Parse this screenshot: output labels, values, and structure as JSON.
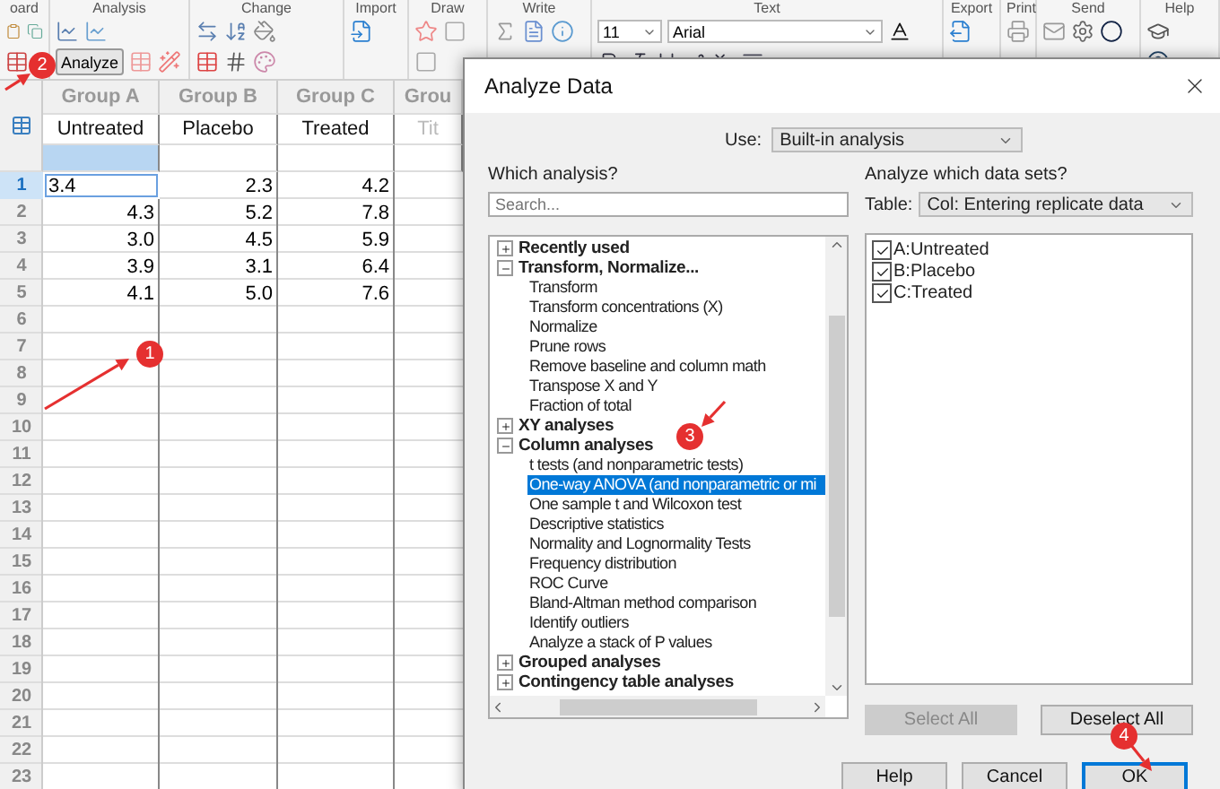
{
  "ribbon": [
    {
      "kind": "clipboard",
      "label": "oard"
    },
    {
      "kind": "analysis",
      "label": "Analysis",
      "button": "Analyze"
    },
    {
      "kind": "change",
      "label": "Change"
    },
    {
      "kind": "import",
      "label": "Import"
    },
    {
      "kind": "draw",
      "label": "Draw"
    },
    {
      "kind": "write",
      "label": "Write"
    },
    {
      "kind": "text",
      "label": "Text",
      "font_size": "11",
      "font": "Arial"
    },
    {
      "kind": "export",
      "label": "Export"
    },
    {
      "kind": "print",
      "label": "Print"
    },
    {
      "kind": "send",
      "label": "Send"
    },
    {
      "kind": "help",
      "label": "Help"
    }
  ],
  "sheet": {
    "columns": [
      {
        "group": "Group A",
        "title": "Untreated",
        "selected": true
      },
      {
        "group": "Group B",
        "title": "Placebo",
        "selected": false
      },
      {
        "group": "Group C",
        "title": "Treated",
        "selected": false
      },
      {
        "group": "Grou",
        "title_placeholder": "Tit",
        "selected": false
      }
    ],
    "rows": [
      {
        "number": "1",
        "selected": true,
        "editing": true,
        "cells": [
          "3.4",
          "2.3",
          "4.2"
        ]
      },
      {
        "number": "2",
        "selected": false,
        "editing": false,
        "cells": [
          "4.3",
          "5.2",
          "7.8"
        ]
      },
      {
        "number": "3",
        "selected": false,
        "editing": false,
        "cells": [
          "3.0",
          "4.5",
          "5.9"
        ]
      },
      {
        "number": "4",
        "selected": false,
        "editing": false,
        "cells": [
          "3.9",
          "3.1",
          "6.4"
        ]
      },
      {
        "number": "5",
        "selected": false,
        "editing": false,
        "cells": [
          "4.1",
          "5.0",
          "7.6"
        ]
      },
      {
        "number": "6",
        "selected": false
      },
      {
        "number": "7",
        "selected": false
      },
      {
        "number": "8",
        "selected": false
      },
      {
        "number": "9",
        "selected": false
      },
      {
        "number": "10",
        "selected": false
      },
      {
        "number": "11",
        "selected": false
      },
      {
        "number": "12",
        "selected": false
      },
      {
        "number": "13",
        "selected": false
      },
      {
        "number": "14",
        "selected": false
      },
      {
        "number": "15",
        "selected": false
      },
      {
        "number": "16",
        "selected": false
      },
      {
        "number": "17",
        "selected": false
      },
      {
        "number": "18",
        "selected": false
      },
      {
        "number": "19",
        "selected": false
      },
      {
        "number": "20",
        "selected": false
      },
      {
        "number": "21",
        "selected": false
      },
      {
        "number": "22",
        "selected": false
      },
      {
        "number": "23",
        "selected": false
      }
    ]
  },
  "dialog": {
    "title": "Analyze Data",
    "use_label": "Use:",
    "use_value": "Built-in analysis",
    "left_heading": "Which analysis?",
    "search": {
      "placeholder": "Search..."
    },
    "tree": [
      {
        "label": "Recently used",
        "kind": "group",
        "expanded": false,
        "selected": false
      },
      {
        "label": "Transform, Normalize...",
        "kind": "group",
        "expanded": true,
        "selected": false,
        "children": [
          {
            "label": "Transform",
            "kind": "leaf",
            "selected": false
          },
          {
            "label": "Transform concentrations (X)",
            "kind": "leaf",
            "selected": false
          },
          {
            "label": "Normalize",
            "kind": "leaf",
            "selected": false
          },
          {
            "label": "Prune rows",
            "kind": "leaf",
            "selected": false
          },
          {
            "label": "Remove baseline and column math",
            "kind": "leaf",
            "selected": false
          },
          {
            "label": "Transpose X and Y",
            "kind": "leaf",
            "selected": false
          },
          {
            "label": "Fraction of total",
            "kind": "leaf",
            "selected": false
          }
        ]
      },
      {
        "label": "XY analyses",
        "kind": "group",
        "expanded": false,
        "selected": false
      },
      {
        "label": "Column analyses",
        "kind": "group",
        "expanded": true,
        "selected": false,
        "children": [
          {
            "label": "t tests (and nonparametric tests)",
            "kind": "leaf",
            "selected": false
          },
          {
            "label": "One-way ANOVA (and nonparametric or mi",
            "kind": "leaf",
            "selected": true
          },
          {
            "label": "One sample t and Wilcoxon test",
            "kind": "leaf",
            "selected": false
          },
          {
            "label": "Descriptive statistics",
            "kind": "leaf",
            "selected": false
          },
          {
            "label": "Normality and Lognormality Tests",
            "kind": "leaf",
            "selected": false
          },
          {
            "label": "Frequency distribution",
            "kind": "leaf",
            "selected": false
          },
          {
            "label": "ROC Curve",
            "kind": "leaf",
            "selected": false
          },
          {
            "label": "Bland-Altman method comparison",
            "kind": "leaf",
            "selected": false
          },
          {
            "label": "Identify outliers",
            "kind": "leaf",
            "selected": false
          },
          {
            "label": "Analyze a stack of P values",
            "kind": "leaf",
            "selected": false
          }
        ]
      },
      {
        "label": "Grouped analyses",
        "kind": "group",
        "expanded": false,
        "selected": false
      },
      {
        "label": "Contingency table analyses",
        "kind": "group",
        "expanded": false,
        "selected": false
      }
    ],
    "right_heading": "Analyze which data sets?",
    "table_label": "Table:",
    "table_value": "Col: Entering replicate data",
    "data_sets": [
      {
        "label": "A:Untreated",
        "checked": true
      },
      {
        "label": "B:Placebo",
        "checked": true
      },
      {
        "label": "C:Treated",
        "checked": true
      }
    ],
    "buttons": [
      {
        "label": "Select All",
        "disabled": true
      },
      {
        "label": "Deselect All",
        "disabled": false
      }
    ],
    "footer_buttons": [
      {
        "label": "Help",
        "focused": false
      },
      {
        "label": "Cancel",
        "focused": false
      },
      {
        "label": "OK",
        "focused": true
      }
    ]
  },
  "annotations": [
    {
      "label": "1"
    },
    {
      "label": "2"
    },
    {
      "label": "3"
    },
    {
      "label": "4"
    }
  ]
}
